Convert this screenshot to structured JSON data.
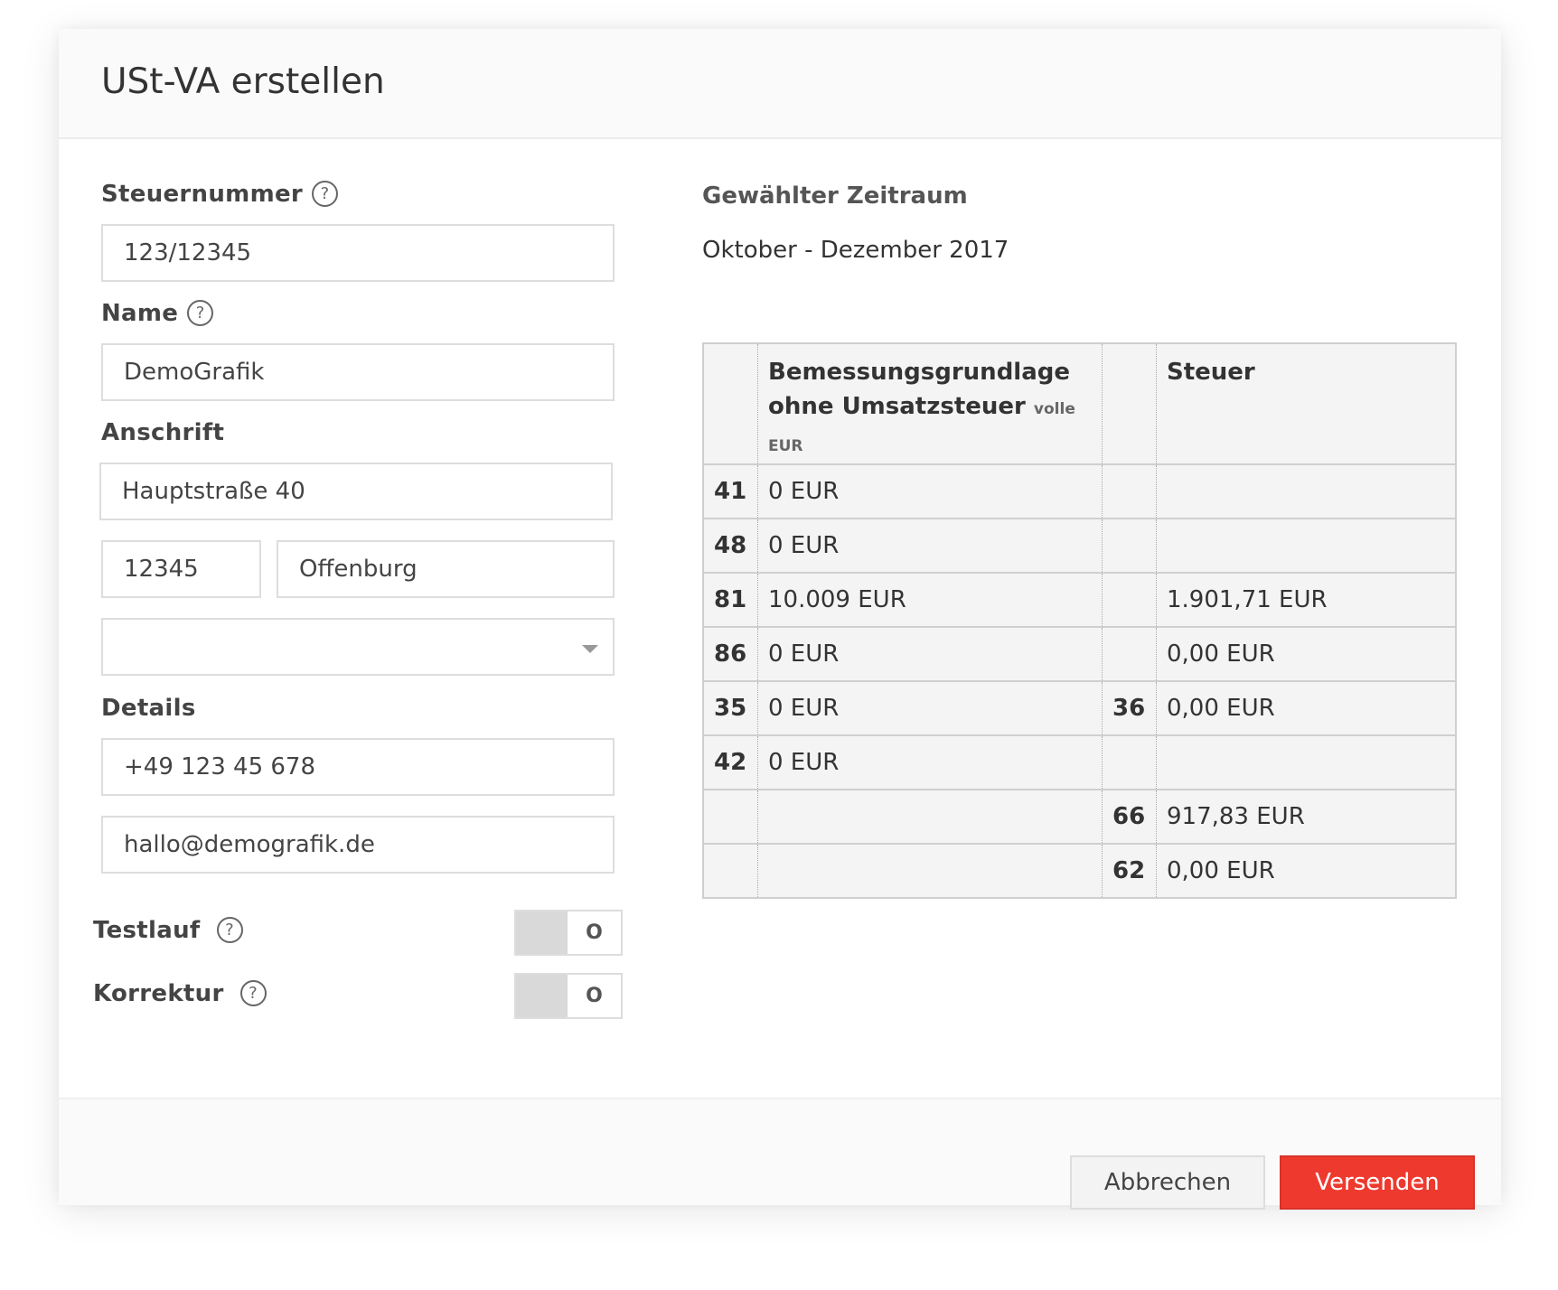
{
  "dialog": {
    "title": "USt-VA erstellen"
  },
  "form": {
    "tax_number_label": "Steuernummer",
    "tax_number_value": "123/12345",
    "name_label": "Name",
    "name_value": "DemoGrafik",
    "address_label": "Anschrift",
    "street_value": "Hauptstraße 40",
    "zip_value": "12345",
    "city_value": "Offenburg",
    "country_value": "",
    "details_label": "Details",
    "phone_value": "+49 123 45 678",
    "email_value": "hallo@demografik.de",
    "test_run_label": "Testlauf",
    "test_run_state": "O",
    "correction_label": "Korrektur",
    "correction_state": "O",
    "help_glyph": "?"
  },
  "period": {
    "label": "Gewählter Zeitraum",
    "value": "Oktober - Dezember 2017"
  },
  "tax_table": {
    "header_base_line1": "Bemessungsgrundlage",
    "header_base_line2": "ohne Umsatzsteuer",
    "header_base_unit": "volle EUR",
    "header_tax": "Steuer",
    "rows": [
      {
        "code": "41",
        "base": "0 EUR",
        "tax_code": "",
        "tax": ""
      },
      {
        "code": "48",
        "base": "0 EUR",
        "tax_code": "",
        "tax": ""
      },
      {
        "code": "81",
        "base": "10.009 EUR",
        "tax_code": "",
        "tax": "1.901,71 EUR"
      },
      {
        "code": "86",
        "base": "0 EUR",
        "tax_code": "",
        "tax": "0,00 EUR"
      },
      {
        "code": "35",
        "base": "0 EUR",
        "tax_code": "36",
        "tax": "0,00 EUR"
      },
      {
        "code": "42",
        "base": "0 EUR",
        "tax_code": "",
        "tax": ""
      },
      {
        "code": "",
        "base": "",
        "tax_code": "66",
        "tax": "917,83 EUR"
      },
      {
        "code": "",
        "base": "",
        "tax_code": "62",
        "tax": "0,00 EUR"
      }
    ]
  },
  "footer": {
    "cancel_label": "Abbrechen",
    "send_label": "Versenden"
  },
  "colors": {
    "primary_button": "#ee3a2e"
  }
}
